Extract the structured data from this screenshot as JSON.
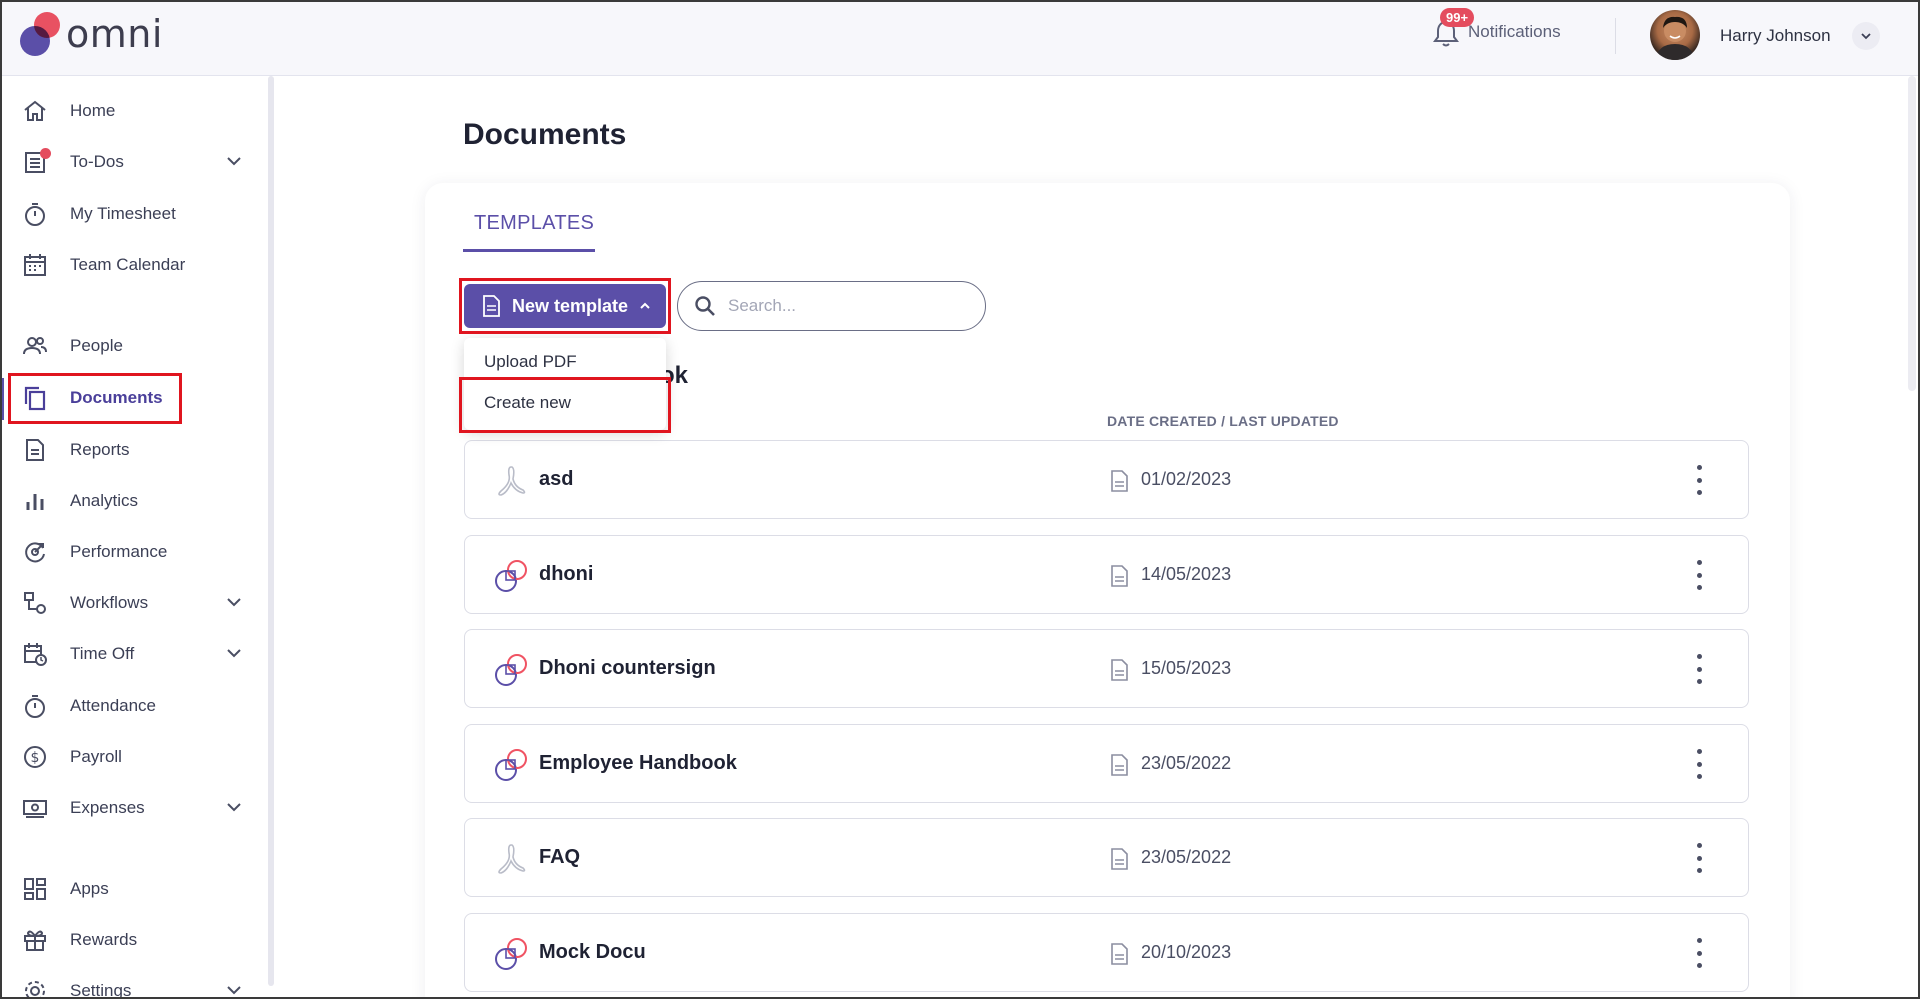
{
  "header": {
    "logo_text": "omni",
    "notifications_badge": "99+",
    "notifications_label": "Notifications",
    "user_name": "Harry Johnson"
  },
  "sidebar": {
    "items": [
      {
        "label": "Home",
        "icon": "home-icon"
      },
      {
        "label": "To-Dos",
        "icon": "checklist-icon",
        "expandable": true
      },
      {
        "label": "My Timesheet",
        "icon": "stopwatch-icon"
      },
      {
        "label": "Team Calendar",
        "icon": "calendar-icon"
      },
      {
        "label": "People",
        "icon": "people-icon"
      },
      {
        "label": "Documents",
        "icon": "documents-icon",
        "active": true
      },
      {
        "label": "Reports",
        "icon": "report-icon"
      },
      {
        "label": "Analytics",
        "icon": "bar-chart-icon"
      },
      {
        "label": "Performance",
        "icon": "performance-icon"
      },
      {
        "label": "Workflows",
        "icon": "workflow-icon",
        "expandable": true
      },
      {
        "label": "Time Off",
        "icon": "time-off-icon",
        "expandable": true
      },
      {
        "label": "Attendance",
        "icon": "stopwatch-icon"
      },
      {
        "label": "Payroll",
        "icon": "dollar-icon"
      },
      {
        "label": "Expenses",
        "icon": "cash-icon",
        "expandable": true
      },
      {
        "label": "Apps",
        "icon": "apps-icon"
      },
      {
        "label": "Rewards",
        "icon": "gift-icon"
      },
      {
        "label": "Settings",
        "icon": "gear-icon",
        "expandable": true
      }
    ]
  },
  "main": {
    "page_title": "Documents",
    "tab_label": "TEMPLATES",
    "new_template_label": "New template",
    "search_placeholder": "Search...",
    "dropdown": {
      "upload_pdf": "Upload PDF",
      "create_new": "Create new"
    },
    "folder_title_peek": "ok",
    "column_header_date": "DATE CREATED / LAST UPDATED",
    "documents": [
      {
        "name": "asd",
        "date": "01/02/2023",
        "type": "pdf"
      },
      {
        "name": "dhoni",
        "date": "14/05/2023",
        "type": "omni"
      },
      {
        "name": "Dhoni countersign",
        "date": "15/05/2023",
        "type": "omni"
      },
      {
        "name": "Employee Handbook",
        "date": "23/05/2022",
        "type": "omni"
      },
      {
        "name": "FAQ",
        "date": "23/05/2022",
        "type": "pdf"
      },
      {
        "name": "Mock Docu",
        "date": "20/10/2023",
        "type": "omni"
      }
    ]
  },
  "colors": {
    "brand_purple": "#5b4fa8",
    "brand_red": "#f05363",
    "highlight_red": "#e0151f"
  }
}
